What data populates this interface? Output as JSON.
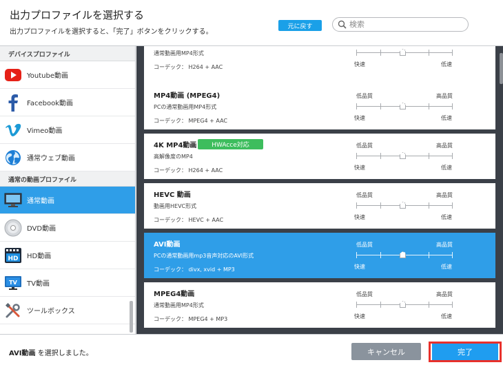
{
  "header": {
    "title": "出力プロファイルを選択する",
    "subtitle": "出力プロファイルを選択すると、「完了」ボタンをクリックする。",
    "back_label": "元に戻す",
    "search_placeholder": "検索"
  },
  "sidebar": {
    "device_header": "デバイスプロファイル",
    "device_items": [
      {
        "label": "Youtube動画",
        "icon": "youtube-icon"
      },
      {
        "label": "Facebook動画",
        "icon": "facebook-icon"
      },
      {
        "label": "Vimeo動画",
        "icon": "vimeo-icon"
      },
      {
        "label": "通常ウェブ動画",
        "icon": "globe-icon"
      }
    ],
    "video_header": "通常の動画プロファイル",
    "video_items": [
      {
        "label": "通常動画",
        "icon": "monitor-icon",
        "selected": true
      },
      {
        "label": "DVD動画",
        "icon": "dvd-icon"
      },
      {
        "label": "HD動画",
        "icon": "hd-icon"
      },
      {
        "label": "TV動画",
        "icon": "tv-icon"
      },
      {
        "label": "ツールボックス",
        "icon": "tools-icon"
      }
    ]
  },
  "profiles": [
    {
      "name": "",
      "desc": "通常動画用MP4形式",
      "codec": "コーデック： H264 + AAC",
      "quality_low": "",
      "quality_high": "",
      "speed_fast": "快速",
      "speed_slow": "低速"
    },
    {
      "name": "MP4動画 (MPEG4)",
      "desc": "PCの通常動画用MP4形式",
      "codec": "コーデック： MPEG4 + AAC",
      "quality_low": "低品質",
      "quality_high": "高品質",
      "speed_fast": "快速",
      "speed_slow": "低速"
    },
    {
      "name": "4K MP4動画",
      "badge": "HWAcce対応",
      "desc": "高解像度のMP4",
      "codec": "コーデック： H264 + AAC",
      "quality_low": "低品質",
      "quality_high": "高品質",
      "speed_fast": "快速",
      "speed_slow": "低速"
    },
    {
      "name": "HEVC 動画",
      "desc": "動画用HEVC形式",
      "codec": "コーデック： HEVC + AAC",
      "quality_low": "低品質",
      "quality_high": "高品質",
      "speed_fast": "快速",
      "speed_slow": "低速"
    },
    {
      "name": "AVI動画",
      "desc": "PCの通常動画用mp3音声対応のAVI形式",
      "codec": "コーデック： divx, xvid + MP3",
      "quality_low": "低品質",
      "quality_high": "高品質",
      "speed_fast": "快速",
      "speed_slow": "低速",
      "selected": true
    },
    {
      "name": "MPEG4動画",
      "desc": "通常動画用MP4形式",
      "codec": "コーデック： MPEG4 + MP3",
      "quality_low": "低品質",
      "quality_high": "高品質",
      "speed_fast": "快速",
      "speed_slow": "低速"
    }
  ],
  "footer": {
    "status_name": "AVI動画",
    "status_suffix": " を選択しました。",
    "cancel_label": "キャンセル",
    "done_label": "完了"
  },
  "colors": {
    "accent": "#2f9ee8",
    "badge": "#3dbd5d",
    "highlight_outline": "#e8302b",
    "list_background": "#3b4048"
  }
}
